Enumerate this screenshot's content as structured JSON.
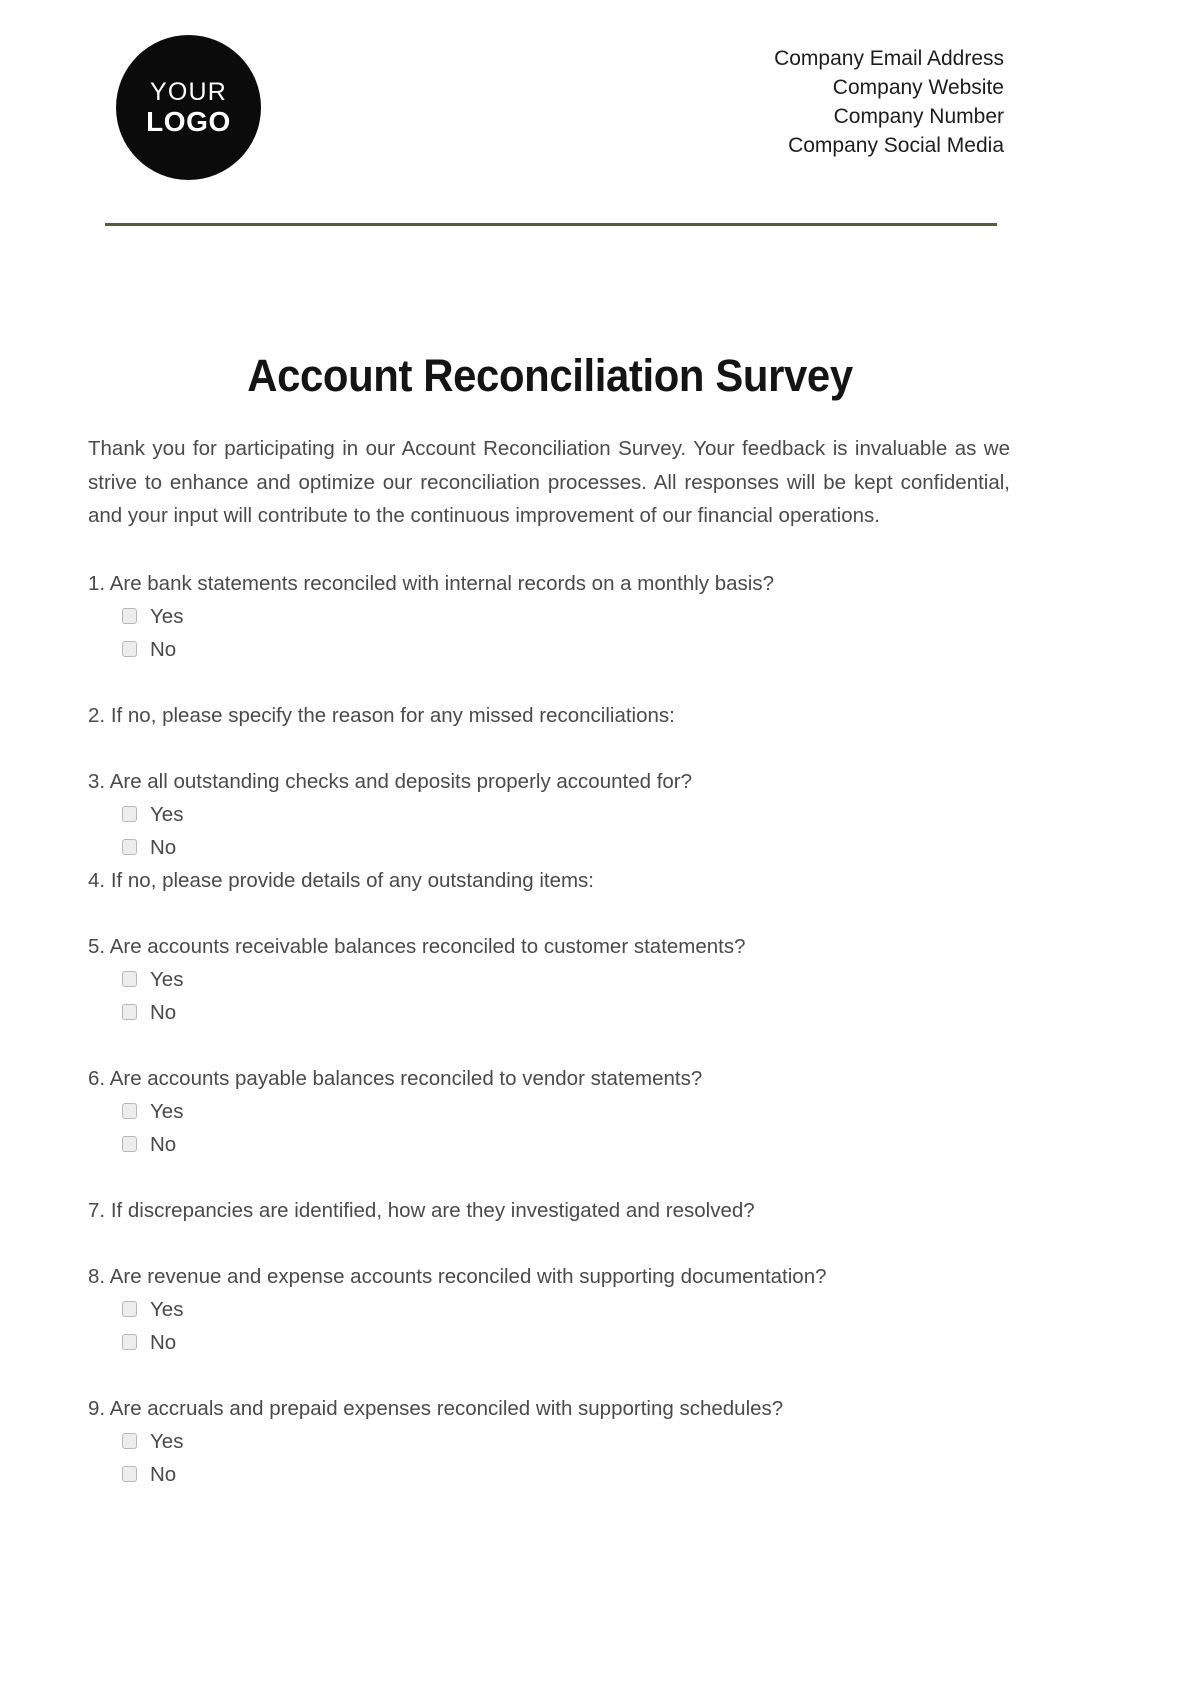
{
  "header": {
    "logo": {
      "line1": "YOUR",
      "line2": "LOGO"
    },
    "contact_lines": [
      "Company Email Address",
      "Company Website",
      "Company Number",
      "Company Social Media"
    ],
    "divider_color": "#585b42"
  },
  "document": {
    "title": "Account Reconciliation Survey",
    "intro": "Thank you for participating in our Account Reconciliation Survey. Your feedback is invaluable as we strive to enhance and optimize our reconciliation processes. All responses will be kept confidential, and your input will contribute to the continuous improvement of our financial operations."
  },
  "questions": [
    {
      "number": "1.",
      "text": "Are bank statements reconciled with internal records on a monthly basis?",
      "options": [
        "Yes",
        "No"
      ]
    },
    {
      "number": "2.",
      "text": "If no, please specify the reason for any missed reconciliations:",
      "options": []
    },
    {
      "number": "3.",
      "text": "Are all outstanding checks and deposits properly accounted for?",
      "options": [
        "Yes",
        "No"
      ]
    },
    {
      "number": "4.",
      "text": "If no, please provide details of any outstanding items:",
      "options": []
    },
    {
      "number": "5.",
      "text": "Are accounts receivable balances reconciled to customer statements?",
      "options": [
        "Yes",
        "No"
      ]
    },
    {
      "number": "6.",
      "text": "Are accounts payable balances reconciled to vendor statements?",
      "options": [
        "Yes",
        "No"
      ]
    },
    {
      "number": "7.",
      "text": "If discrepancies are identified, how are they investigated and resolved?",
      "options": []
    },
    {
      "number": "8.",
      "text": "Are revenue and expense accounts reconciled with supporting documentation?",
      "options": [
        "Yes",
        "No"
      ]
    },
    {
      "number": "9.",
      "text": "Are accruals and prepaid expenses reconciled with supporting schedules?",
      "options": [
        "Yes",
        "No"
      ]
    }
  ]
}
